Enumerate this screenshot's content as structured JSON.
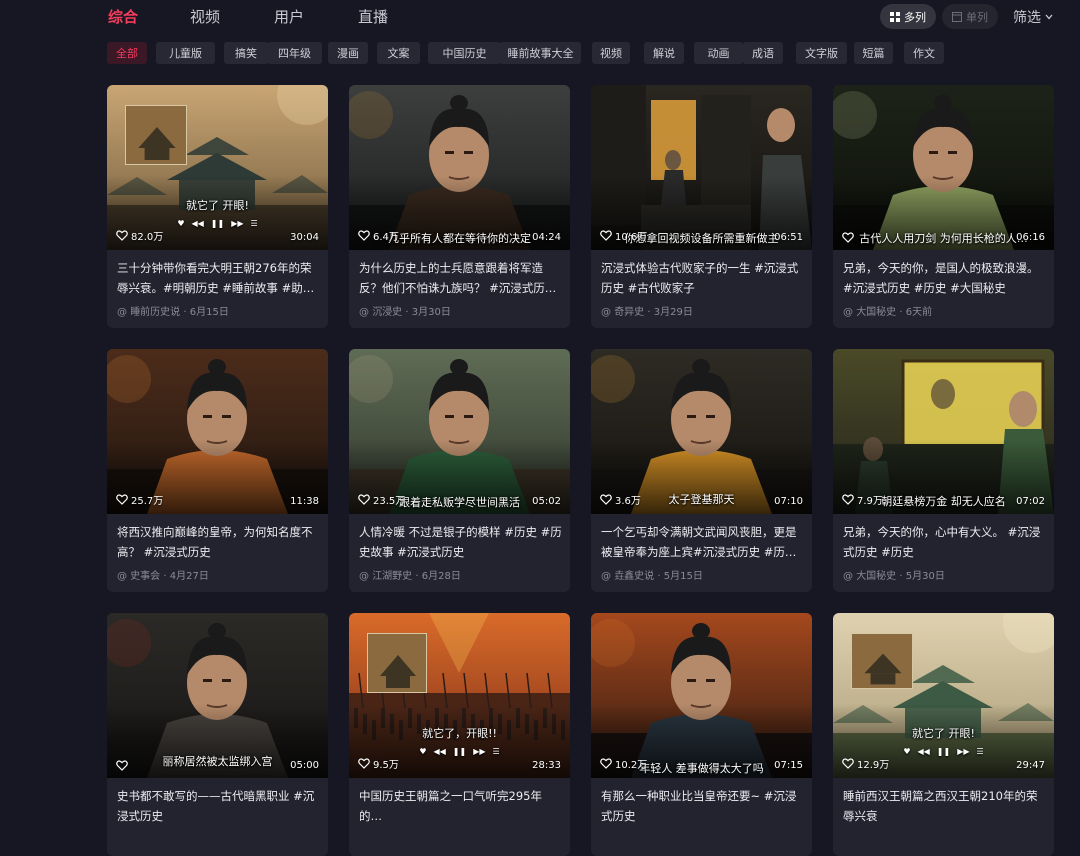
{
  "tabs": [
    {
      "label": "综合",
      "active": true
    },
    {
      "label": "视频",
      "active": false
    },
    {
      "label": "用户",
      "active": false
    },
    {
      "label": "直播",
      "active": false
    }
  ],
  "view": {
    "multi_label": "多列",
    "single_label": "单列",
    "filter_label": "筛选"
  },
  "chips": [
    "全部",
    "儿童版",
    "搞笑",
    "四年级",
    "漫画",
    "文案",
    "中国历史",
    "睡前故事大全",
    "视频",
    "解说",
    "动画",
    "成语",
    "文字版",
    "短篇",
    "作文"
  ],
  "active_chip": "全部",
  "cards": [
    {
      "thumb_style": "palace-gold",
      "overlay": "就它了 开眼!",
      "likes": "82.0万",
      "duration": "30:04",
      "title": "三十分钟带你看完大明王朝276年的荣辱兴衰。#明朝历史 #睡前故事 #助…",
      "author": "睡前历史说",
      "date": "6月15日"
    },
    {
      "thumb_style": "warrior-dark",
      "overlay": "几乎所有人都在等待你的决定",
      "likes": "6.4万",
      "duration": "04:24",
      "title": "为什么历史上的士兵愿意跟着将军造反？他们不怕诛九族吗？ #沉浸式历…",
      "author": "沉浸史",
      "date": "3月30日"
    },
    {
      "thumb_style": "room-dark",
      "overlay": "你想拿回视频设备所需重新做主",
      "likes": "10.6万",
      "duration": "06:51",
      "title": "沉浸式体验古代败家子的一生 #沉浸式历史 #古代败家子",
      "author": "奇异史",
      "date": "3月29日"
    },
    {
      "thumb_style": "green-face",
      "overlay": "古代人人用刀剑 为何用长枪的人…",
      "likes": "",
      "duration": "06:16",
      "title": "兄弟，今天的你，是国人的极致浪漫。#沉浸式历史 #历史 #大国秘史",
      "author": "大国秘史",
      "date": "6天前"
    },
    {
      "thumb_style": "orange-boy",
      "overlay": "",
      "likes": "25.7万",
      "duration": "11:38",
      "title": "将西汉推向巅峰的皇帝，为何知名度不高？ #沉浸式历史",
      "author": "史事会",
      "date": "4月27日"
    },
    {
      "thumb_style": "green-soldier",
      "overlay": "跟着走私贩学尽世间黑活",
      "likes": "23.5万",
      "duration": "05:02",
      "title": "人情冷暖 不过是银子的模样 #历史 #历史故事 #沉浸式历史",
      "author": "江湖野史",
      "date": "6月28日"
    },
    {
      "thumb_style": "yellow-robe",
      "overlay": "太子登基那天",
      "likes": "3.6万",
      "duration": "07:10",
      "title": "一个乞丐却令满朝文武闻风丧胆，更是被皇帝奉为座上宾#沉浸式历史 #历…",
      "author": "垚鑫史说",
      "date": "5月15日"
    },
    {
      "thumb_style": "scroll-yellow",
      "overlay": "朝廷悬榜万金 却无人应名",
      "likes": "7.9万",
      "duration": "07:02",
      "title": "兄弟，今天的你，心中有大义。 #沉浸式历史 #历史",
      "author": "大国秘史",
      "date": "5月30日"
    },
    {
      "thumb_style": "bloody-man",
      "overlay": "丽称居然被太监绑入宫",
      "likes": "",
      "duration": "05:00",
      "title": "史书都不敢写的——古代暗黑职业 #沉浸式历史",
      "author": "",
      "date": ""
    },
    {
      "thumb_style": "battle-red",
      "overlay": "就它了，开眼!!",
      "likes": "9.5万",
      "duration": "28:33",
      "title": "中国历史王朝篇之一口气听完295年的…",
      "author": "",
      "date": ""
    },
    {
      "thumb_style": "fire-man",
      "overlay": "年轻人 差事做得太大了吗",
      "likes": "10.2万",
      "duration": "07:15",
      "title": "有那么一种职业比当皇帝还要~ #沉浸式历史",
      "author": "",
      "date": ""
    },
    {
      "thumb_style": "palace-green",
      "overlay": "就它了 开眼!",
      "likes": "12.9万",
      "duration": "29:47",
      "title": "睡前西汉王朝篇之西汉王朝210年的荣辱兴衰",
      "author": "",
      "date": ""
    }
  ]
}
